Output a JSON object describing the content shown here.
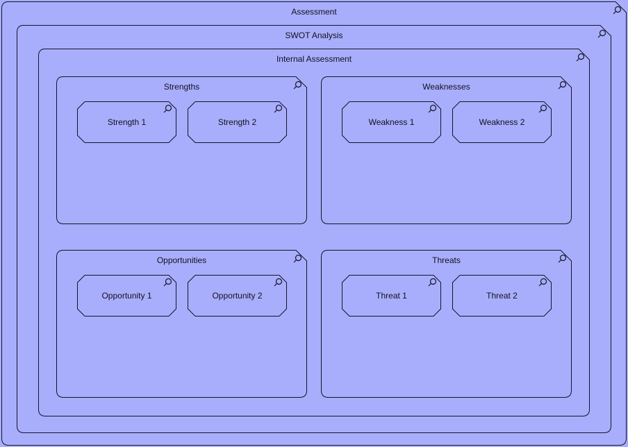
{
  "diagram": {
    "type": "nested-grouping",
    "title": "Assessment",
    "icon": "magnifier-icon",
    "colors": {
      "fill": "#a9aefc",
      "stroke": "#13132b",
      "text": "#10101f"
    },
    "levels": [
      {
        "depth": 0,
        "label": "Assessment"
      },
      {
        "depth": 1,
        "label": "SWOT Analysis"
      },
      {
        "depth": 2,
        "label": "Internal Assessment"
      }
    ],
    "quadrants": [
      {
        "id": "strengths",
        "label": "Strengths",
        "icon": "magnifier-icon",
        "items": [
          {
            "id": "strength-1",
            "label": "Strength 1",
            "icon": "magnifier-icon"
          },
          {
            "id": "strength-2",
            "label": "Strength 2",
            "icon": "magnifier-icon"
          }
        ]
      },
      {
        "id": "weaknesses",
        "label": "Weaknesses",
        "icon": "magnifier-icon",
        "items": [
          {
            "id": "weakness-1",
            "label": "Weakness 1",
            "icon": "magnifier-icon"
          },
          {
            "id": "weakness-2",
            "label": "Weakness 2",
            "icon": "magnifier-icon"
          }
        ]
      },
      {
        "id": "opportunities",
        "label": "Opportunities",
        "icon": "magnifier-icon",
        "items": [
          {
            "id": "opportunity-1",
            "label": "Opportunity 1",
            "icon": "magnifier-icon"
          },
          {
            "id": "opportunity-2",
            "label": "Opportunity 2",
            "icon": "magnifier-icon"
          }
        ]
      },
      {
        "id": "threats",
        "label": "Threats",
        "icon": "magnifier-icon",
        "items": [
          {
            "id": "threat-1",
            "label": "Threat 1",
            "icon": "magnifier-icon"
          },
          {
            "id": "threat-2",
            "label": "Threat 2",
            "icon": "magnifier-icon"
          }
        ]
      }
    ]
  }
}
